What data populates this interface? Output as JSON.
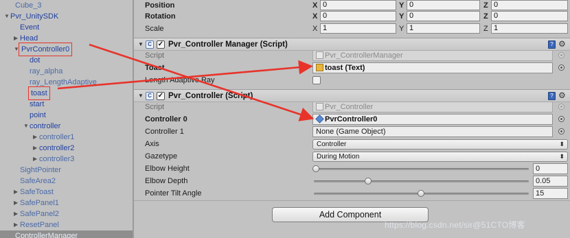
{
  "hierarchy": {
    "items": [
      {
        "label": "Cube_3",
        "indent": 1,
        "arrow": "",
        "style": "gray"
      },
      {
        "label": "Pvr_UnitySDK",
        "indent": 0,
        "arrow": "down",
        "style": ""
      },
      {
        "label": "Event",
        "indent": 2,
        "arrow": "",
        "style": ""
      },
      {
        "label": "Head",
        "indent": 2,
        "arrow": "right",
        "style": ""
      },
      {
        "label": "PvrController0",
        "indent": 2,
        "arrow": "down",
        "style": "",
        "boxed": true
      },
      {
        "label": "dot",
        "indent": 4,
        "arrow": "",
        "style": ""
      },
      {
        "label": "ray_alpha",
        "indent": 4,
        "arrow": "",
        "style": "gray"
      },
      {
        "label": "ray_LengthAdaptive",
        "indent": 4,
        "arrow": "",
        "style": "gray"
      },
      {
        "label": "toast",
        "indent": 4,
        "arrow": "",
        "style": "",
        "boxed": true
      },
      {
        "label": "start",
        "indent": 4,
        "arrow": "",
        "style": ""
      },
      {
        "label": "point",
        "indent": 4,
        "arrow": "",
        "style": ""
      },
      {
        "label": "controller",
        "indent": 4,
        "arrow": "down",
        "style": ""
      },
      {
        "label": "controller1",
        "indent": 6,
        "arrow": "right",
        "style": "gray"
      },
      {
        "label": "controller2",
        "indent": 6,
        "arrow": "right",
        "style": ""
      },
      {
        "label": "controller3",
        "indent": 6,
        "arrow": "right",
        "style": "gray"
      },
      {
        "label": "SightPointer",
        "indent": 2,
        "arrow": "",
        "style": "gray"
      },
      {
        "label": "SafeArea2",
        "indent": 2,
        "arrow": "",
        "style": "gray"
      },
      {
        "label": "SafeToast",
        "indent": 2,
        "arrow": "right",
        "style": "gray"
      },
      {
        "label": "SafePanel1",
        "indent": 2,
        "arrow": "right",
        "style": "gray"
      },
      {
        "label": "SafePanel2",
        "indent": 2,
        "arrow": "right",
        "style": "gray"
      },
      {
        "label": "ResetPanel",
        "indent": 2,
        "arrow": "right",
        "style": "gray"
      },
      {
        "label": "ControllerManager",
        "indent": 1,
        "arrow": "",
        "style": "sel"
      }
    ]
  },
  "transform": {
    "position": {
      "label": "Position",
      "x": "0",
      "y": "0",
      "z": "0"
    },
    "rotation": {
      "label": "Rotation",
      "x": "0",
      "y": "0",
      "z": "0"
    },
    "scale": {
      "label": "Scale",
      "x": "1",
      "y": "1",
      "z": "1"
    },
    "axes": {
      "x": "X",
      "y": "Y",
      "z": "Z"
    }
  },
  "manager": {
    "title": "Pvr_Controller Manager (Script)",
    "script_label": "Script",
    "script_value": "Pvr_ControllerManager",
    "toast_label": "Toast",
    "toast_value": "toast (Text)",
    "length_label": "Length Adaptive Ray"
  },
  "controller": {
    "title": "Pvr_Controller (Script)",
    "script_label": "Script",
    "script_value": "Pvr_Controller",
    "c0_label": "Controller 0",
    "c0_value": "PvrController0",
    "c1_label": "Controller 1",
    "c1_value": "None (Game Object)",
    "axis_label": "Axis",
    "axis_value": "Controller",
    "gaze_label": "Gazetype",
    "gaze_value": "During Motion",
    "elbow_h_label": "Elbow Height",
    "elbow_h_value": "0",
    "elbow_h_fraction": 0.0,
    "elbow_d_label": "Elbow Depth",
    "elbow_d_value": "0.05",
    "elbow_d_fraction": 0.25,
    "tilt_label": "Pointer Tilt Angle",
    "tilt_value": "15",
    "tilt_fraction": 0.5
  },
  "add_component": "Add Component",
  "watermark": "https://blog.csdn.net/sir@51CTO博客",
  "colors": {
    "annotation_red": "#e8332a",
    "selection": "#8e8e8e",
    "hierarchy_text": "#2040a0"
  }
}
